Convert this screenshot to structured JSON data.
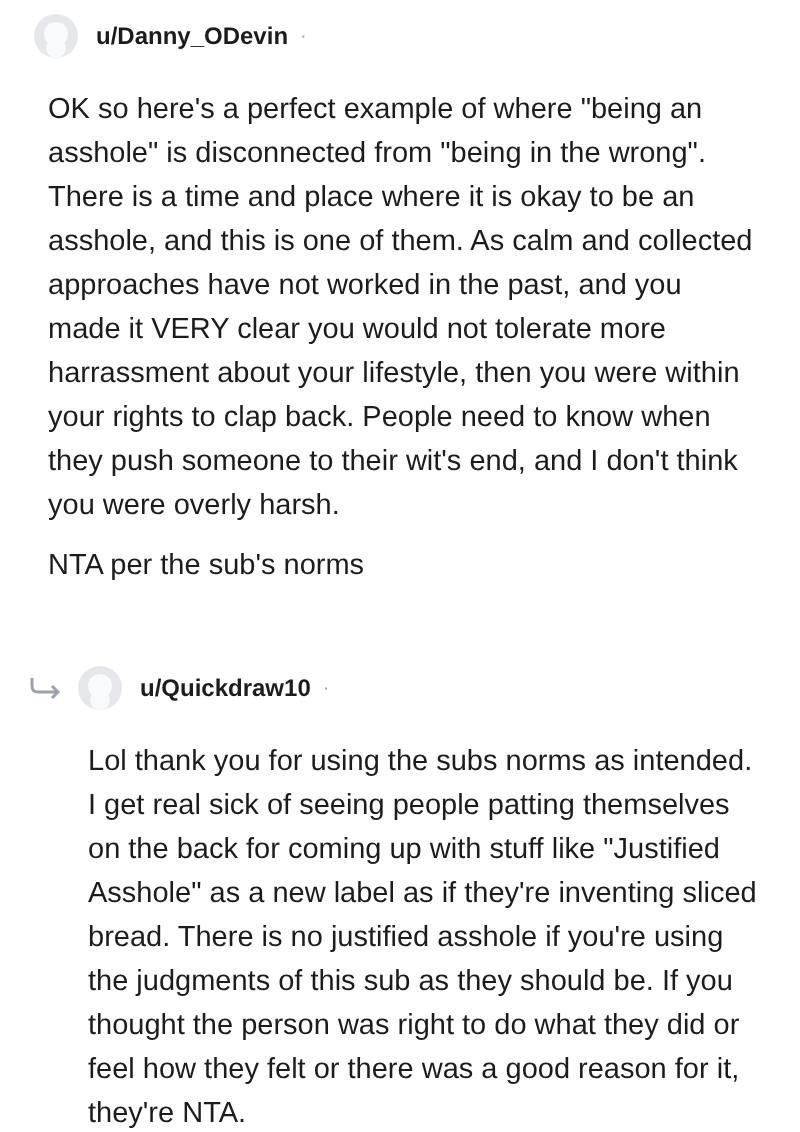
{
  "comments": [
    {
      "author": "u/Danny_ODevin",
      "separator": "·",
      "reply": false,
      "paragraphs": [
        "OK so here's a perfect example of where \"being an asshole\" is disconnected from \"being in the wrong\". There is a time and place where it is okay to be an asshole, and this is one of them. As calm and collected approaches have not worked in the past, and you made it VERY clear you would not tolerate more harrassment about your lifestyle, then you were within your rights to clap back. People need to know when they push someone to their wit's end, and I don't think you were overly harsh.",
        "NTA per the sub's norms"
      ]
    },
    {
      "author": "u/Quickdraw10",
      "separator": "·",
      "reply": true,
      "paragraphs": [
        "Lol thank you for using the subs norms as intended. I get real sick of seeing people patting themselves on the back for coming up with stuff like \"Justified Asshole\" as a new label as if they're inventing sliced bread. There is no justified asshole if you're using the judgments of this sub as they should be. If you thought the person was right to do what they did or feel how they felt or there was a good reason for it, they're NTA."
      ]
    }
  ]
}
